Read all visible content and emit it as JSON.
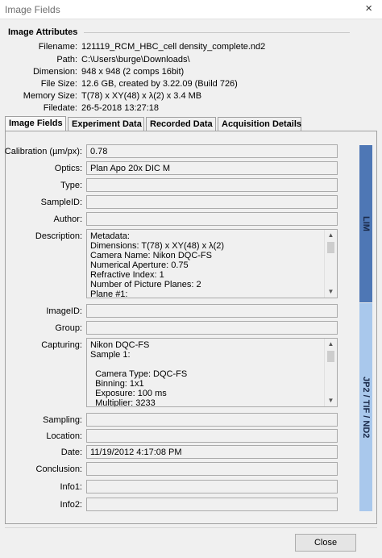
{
  "window": {
    "title": "Image Fields",
    "close_glyph": "×",
    "close_icon": "close-icon"
  },
  "attributes": {
    "title": "Image Attributes",
    "rows": [
      {
        "label": "Filename:",
        "value": "121119_RCM_HBC_cell density_complete.nd2"
      },
      {
        "label": "Path:",
        "value": "C:\\Users\\burge\\Downloads\\"
      },
      {
        "label": "Dimension:",
        "value": "948 x 948 (2 comps 16bit)"
      },
      {
        "label": "File Size:",
        "value": "12.6 GB, created by 3.22.09 (Build 726)"
      },
      {
        "label": "Memory Size:",
        "value": "T(78) x XY(48) x λ(2) x 3.4 MB"
      },
      {
        "label": "Filedate:",
        "value": "26-5-2018  13:27:18"
      }
    ]
  },
  "tabs": [
    {
      "label": "Image Fields",
      "active": true
    },
    {
      "label": "Experiment Data",
      "active": false
    },
    {
      "label": "Recorded Data",
      "active": false
    },
    {
      "label": "Acquisition Details",
      "active": false
    }
  ],
  "fields": {
    "calibration": {
      "label": "Calibration (µm/px):",
      "value": "0.78"
    },
    "optics": {
      "label": "Optics:",
      "value": "Plan Apo 20x DIC M"
    },
    "type": {
      "label": "Type:",
      "value": ""
    },
    "sampleid": {
      "label": "SampleID:",
      "value": ""
    },
    "author": {
      "label": "Author:",
      "value": ""
    },
    "description": {
      "label": "Description:",
      "value": "Metadata:\nDimensions: T(78) x XY(48) x λ(2)\nCamera Name: Nikon DQC-FS\nNumerical Aperture: 0.75\nRefractive Index: 1\nNumber of Picture Planes: 2\nPlane #1:"
    },
    "imageid": {
      "label": "ImageID:",
      "value": ""
    },
    "group": {
      "label": "Group:",
      "value": ""
    },
    "capturing": {
      "label": "Capturing:",
      "value": "Nikon DQC-FS\nSample 1:\n\n  Camera Type: DQC-FS\n  Binning: 1x1\n  Exposure: 100 ms\n  Multiplier: 3233"
    },
    "sampling": {
      "label": "Sampling:",
      "value": ""
    },
    "location": {
      "label": "Location:",
      "value": ""
    },
    "date": {
      "label": "Date:",
      "value": "11/19/2012  4:17:08 PM"
    },
    "conclusion": {
      "label": "Conclusion:",
      "value": ""
    },
    "info1": {
      "label": "Info1:",
      "value": ""
    },
    "info2": {
      "label": "Info2:",
      "value": ""
    }
  },
  "side_tabs": {
    "lim": "LIM",
    "jp2": "JP2 / TIF / ND2"
  },
  "colors": {
    "lim_tab": "#4e77b5",
    "jp2_tab": "#a9c8ec"
  },
  "footer": {
    "close_label": "Close"
  }
}
